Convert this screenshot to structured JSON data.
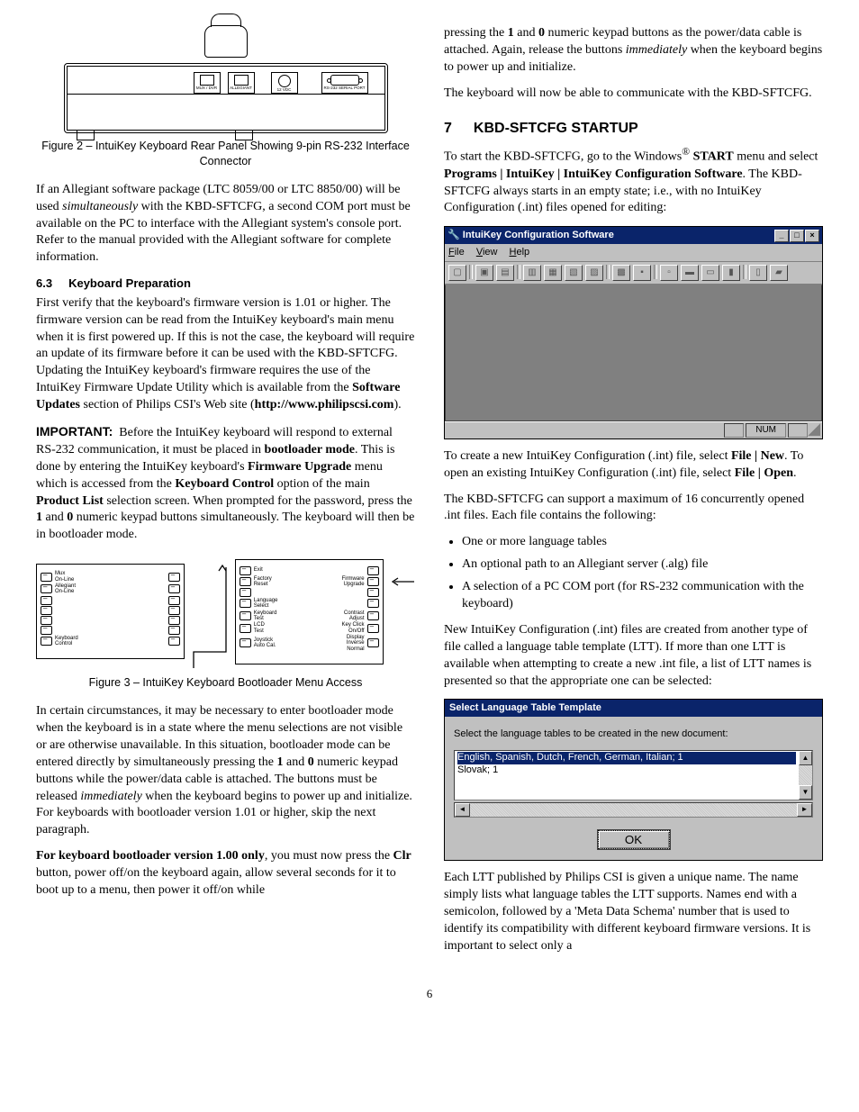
{
  "page_number": "6",
  "left": {
    "fig2": {
      "labels": {
        "p1": "MUX / DVR",
        "p2": "ALLEGIANT",
        "p3": "12 VDC",
        "p4": "RS-232 SERIAL PORT"
      },
      "caption": "Figure 2 – IntuiKey Keyboard Rear Panel Showing 9-pin RS-232 Interface Connector"
    },
    "p1": "If an Allegiant software package (LTC 8059/00 or LTC 8850/00) will be used simultaneously with the KBD-SFTCFG, a second COM port must be available on the PC to interface with the Allegiant system's console port. Refer to the manual provided with the Allegiant software for complete information.",
    "sub63_num": "6.3",
    "sub63_title": "Keyboard Preparation",
    "p2": "First verify that the keyboard's firmware version is 1.01 or higher. The firmware version can be read from the IntuiKey keyboard's main menu when it is first powered up. If this is not the case, the keyboard will require an update of its firmware before it can be used with the KBD-SFTCFG. Updating the IntuiKey keyboard's firmware requires the use of the IntuiKey Firmware Update Utility which is available from the Software Updates section of Philips CSI's Web site (http://www.philipscsi.com).",
    "p3": "IMPORTANT:  Before the IntuiKey keyboard will respond to external RS-232 communication, it must be placed in bootloader mode. This is done by entering the IntuiKey keyboard's Firmware Upgrade menu which is accessed from the Keyboard Control option of the main Product List selection screen. When prompted for the password, press the 1 and 0 numeric keypad buttons simultaneously. The keyboard will then be in bootloader mode.",
    "fig3": {
      "left": {
        "rows": [
          [
            "Mux\nOn-Line",
            ""
          ],
          [
            "Allegiant\nOn-Line",
            ""
          ],
          [
            "",
            ""
          ],
          [
            "",
            ""
          ],
          [
            "",
            ""
          ],
          [
            "",
            ""
          ],
          [
            "Keyboard\nControl",
            ""
          ]
        ]
      },
      "right": {
        "rows": [
          [
            "Exit",
            ""
          ],
          [
            "Factory\nReset",
            "Firmware\nUpgrade"
          ],
          [
            "",
            ""
          ],
          [
            "Language\nSelect",
            ""
          ],
          [
            "Keyboard\nTest",
            "Contrast\nAdjust"
          ],
          [
            "LCD\nTest",
            "Key Click\nOn/Off"
          ],
          [
            "Joystick\nAuto Cal.",
            "Display\nInverse\nNormal"
          ]
        ]
      },
      "caption": "Figure 3 – IntuiKey Keyboard Bootloader Menu Access"
    },
    "p4": "In certain circumstances, it may be necessary to enter bootloader mode when the keyboard is in a state where the menu selections are not visible or are otherwise unavailable. In this situation, bootloader mode can be entered directly by simultaneously pressing the 1 and 0 numeric keypad buttons while the power/data cable is attached. The buttons must be released immediately when the keyboard begins to power up and initialize. For keyboards with bootloader version 1.01 or higher, skip the next paragraph.",
    "p5": "For keyboard bootloader version 1.00 only, you must now press the Clr button, power off/on the keyboard again, allow several seconds for it to boot up to a menu, then power it off/on while"
  },
  "right": {
    "p1": "pressing the 1 and 0 numeric keypad buttons as the power/data cable is attached. Again, release the buttons immediately when the keyboard begins to power up and initialize.",
    "p2": "The keyboard will now be able to communicate with the KBD-SFTCFG.",
    "sec7_num": "7",
    "sec7_title": "KBD-SFTCFG STARTUP",
    "p3": "To start the KBD-SFTCFG, go to the Windows® START menu and select Programs | IntuiKey | IntuiKey Configuration Software. The KBD-SFTCFG always starts in an empty state; i.e., with no IntuiKey Configuration (.int) files opened for editing:",
    "appwin": {
      "title": "IntuiKey Configuration Software",
      "menus": [
        "File",
        "View",
        "Help"
      ],
      "status_cells": [
        "",
        "NUM",
        ""
      ]
    },
    "p4": "To create a new IntuiKey Configuration (.int) file, select File | New. To open an existing IntuiKey Configuration (.int) file, select File | Open.",
    "p5": "The KBD-SFTCFG can support a maximum of 16 concurrently opened .int files. Each file contains the following:",
    "bullets": [
      "One or more language tables",
      "An optional path to an Allegiant server (.alg) file",
      "A selection of a PC COM port (for RS-232 communication with the keyboard)"
    ],
    "p6": "New IntuiKey Configuration (.int) files are created from another type of file called a language table template (LTT). If more than one LTT is available when attempting to create a new .int file, a list of LTT names is presented so that the appropriate one can be selected:",
    "dialog": {
      "title": "Select Language Table Template",
      "prompt": "Select the language tables to be created in the new document:",
      "items": [
        "English, Spanish, Dutch, French, German, Italian; 1",
        "Slovak; 1"
      ],
      "ok": "OK"
    },
    "p7": "Each LTT published by Philips CSI is given a unique name. The name simply lists what language tables the LTT supports. Names end with a semicolon, followed by a 'Meta Data Schema' number that is used to identify its compatibility with different keyboard firmware versions. It is important to select only a"
  }
}
